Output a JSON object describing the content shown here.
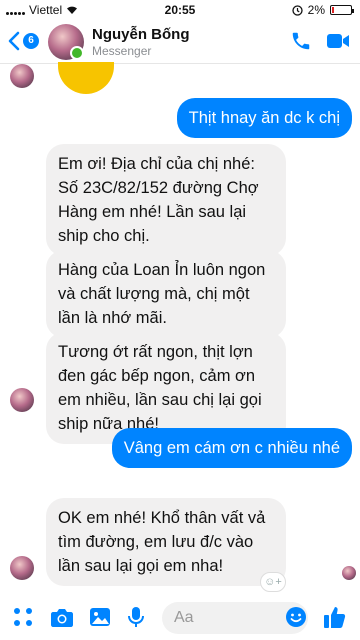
{
  "status_bar": {
    "carrier": "Viettel",
    "time": "20:55",
    "battery": "2%"
  },
  "header": {
    "back_badge": "6",
    "contact_name": "Nguyễn Bống",
    "contact_subtitle": "Messenger"
  },
  "messages": [
    {
      "id": "m1",
      "direction": "out",
      "text": "Thịt hnay ăn dc k chị"
    },
    {
      "id": "m2",
      "direction": "in",
      "lines": [
        "Em ơi! Địa chỉ của chị nhé:",
        "Số 23C/82/152 đường Chợ",
        "Hàng em nhé! Lần sau lại",
        "ship cho chị."
      ]
    },
    {
      "id": "m3",
      "direction": "in",
      "lines": [
        "Hàng của Loan Ỉn luôn ngon",
        "và chất lượng mà, chị một",
        "lần là nhớ mãi."
      ]
    },
    {
      "id": "m4",
      "direction": "in",
      "lines": [
        "Tương ớt rất ngon, thịt lợn",
        "đen gác bếp ngon, cảm ơn",
        "em nhiều, lần sau chị lại gọi",
        "ship nữa nhé!"
      ]
    },
    {
      "id": "m5",
      "direction": "out",
      "text": "Vâng em cám ơn c nhiều nhé"
    },
    {
      "id": "m6",
      "direction": "in",
      "lines": [
        "OK em nhé! Khổ thân vất vả",
        "tìm đường, em lưu đ/c vào",
        "lần sau lại gọi em nha!"
      ]
    }
  ],
  "composer": {
    "placeholder": "Aa"
  },
  "colors": {
    "accent": "#0084ff",
    "incoming_bubble": "#f1f0f0"
  }
}
